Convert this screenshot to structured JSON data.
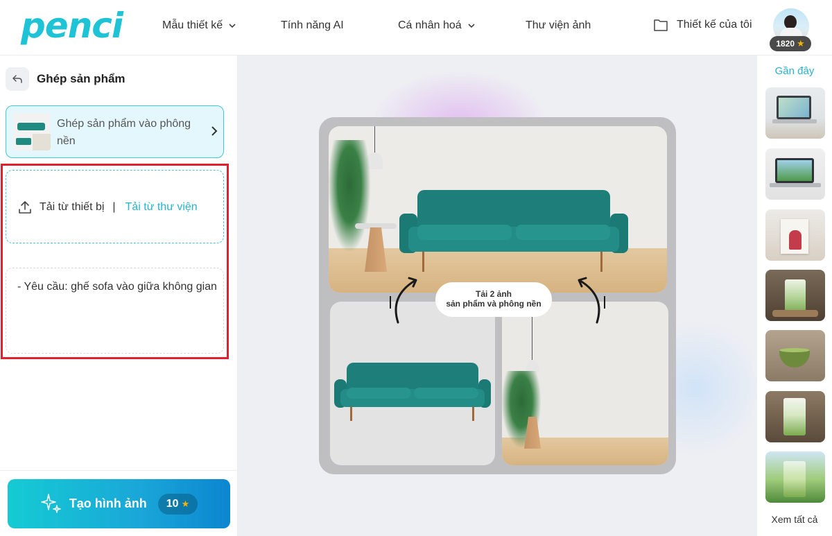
{
  "header": {
    "logo_text": "penci",
    "nav": [
      {
        "label": "Mẫu thiết kế",
        "dropdown": true
      },
      {
        "label": "Tính năng AI",
        "dropdown": false
      },
      {
        "label": "Cá nhân hoá",
        "dropdown": true
      },
      {
        "label": "Thư viện ảnh",
        "dropdown": false
      }
    ],
    "my_designs": "Thiết kế của tôi",
    "credits": "1820"
  },
  "left_panel": {
    "title": "Ghép sản phẩm",
    "tool_card": "Ghép sản phẩm vào phông nền",
    "upload_device": "Tải từ thiết bị",
    "upload_separator": "|",
    "upload_library": "Tải từ thư viện",
    "prompt_text": "- Yêu cầu: ghế sofa vào giữa không gian",
    "generate_label": "Tạo hình ảnh",
    "generate_cost": "10"
  },
  "canvas": {
    "pill_line1": "Tải 2 ảnh",
    "pill_line2": "sản phẩm và phông nền"
  },
  "right_rail": {
    "recent_label": "Gần đây",
    "thumbnails": [
      "laptop-mockup",
      "laptop-green-tea",
      "poster-on-desk",
      "matcha-latte-cafe",
      "matcha-bowl",
      "matcha-latte-glass",
      "matcha-tea-field"
    ],
    "see_all": "Xem tất cả"
  },
  "colors": {
    "accent": "#26b5cc",
    "highlight_border": "#e0202e",
    "sofa": "#1e7f7a"
  }
}
